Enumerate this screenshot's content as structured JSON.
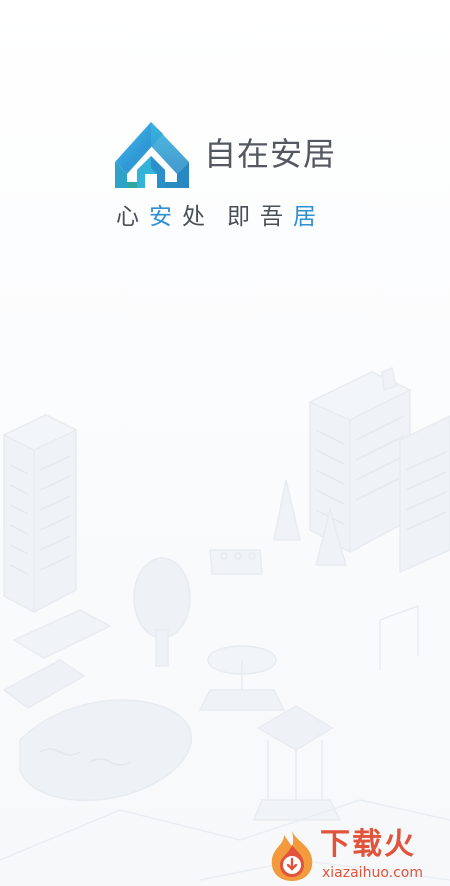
{
  "app": {
    "name": "自在安居",
    "slogan": [
      "心",
      "安",
      "处",
      "即",
      "吾",
      "居"
    ],
    "colors": {
      "accent": "#2f8fd1",
      "logo_gradient_top": "#3fb7e6",
      "logo_gradient_bottom": "#2fa7a0",
      "text": "#545860"
    }
  },
  "watermark": {
    "title": "下载火",
    "url": "xiazaihuo.com",
    "color": "#e2533c"
  },
  "icons": {
    "logo": "house-logo-icon",
    "watermark": "flame-icon"
  }
}
